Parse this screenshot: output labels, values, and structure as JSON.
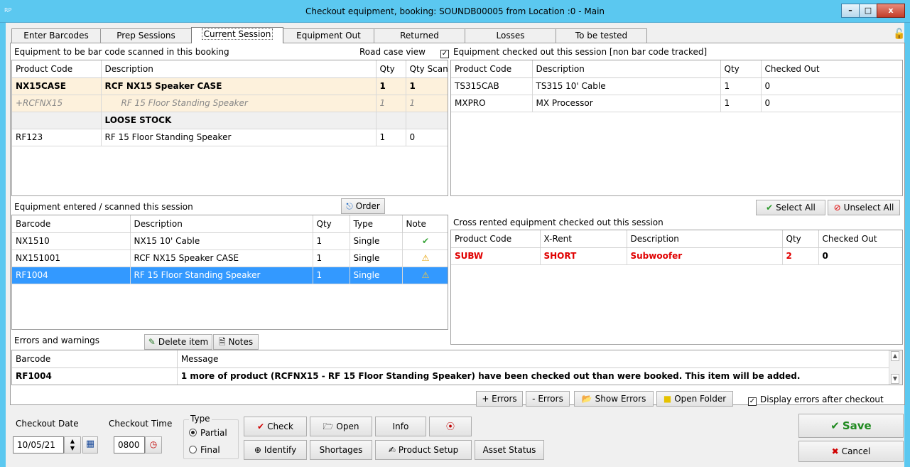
{
  "window": {
    "app_icon": "RP",
    "title": "Checkout equipment,  booking: SOUNDB00005   from Location :0 - Main",
    "min_glyph": "–",
    "max_glyph": "□",
    "close_glyph": "x"
  },
  "tabs": [
    "Enter Barcodes",
    "Prep Sessions",
    "Current Session",
    "Equipment Out",
    "Returned",
    "Losses",
    "To be tested"
  ],
  "booking_grid": {
    "label": "Equipment to be bar code scanned in this booking",
    "road_case_label": "Road case view",
    "road_case_checked": true,
    "columns": [
      "Product Code",
      "Description",
      "Qty",
      "Qty Scanned"
    ],
    "rows": [
      [
        "NX15CASE",
        "RCF NX15 Speaker CASE",
        "1",
        "1"
      ],
      [
        "+RCFNX15",
        "RF 15 Floor Standing Speaker",
        "1",
        "1"
      ],
      [
        "",
        "LOOSE STOCK",
        "",
        ""
      ],
      [
        "RF123",
        "RF 15 Floor Standing Speaker",
        "1",
        "0"
      ]
    ]
  },
  "nonbarcode_grid": {
    "label": "Equipment checked out this session [non bar code tracked]",
    "columns": [
      "Product Code",
      "Description",
      "Qty",
      "Checked Out"
    ],
    "rows": [
      [
        "TS315CAB",
        "TS315 10' Cable",
        "1",
        "0"
      ],
      [
        "MXPRO",
        "MX Processor",
        "1",
        "0"
      ]
    ]
  },
  "scanned_grid": {
    "label": "Equipment entered / scanned this session",
    "order_button": "Order",
    "columns": [
      "Barcode",
      "Description",
      "Qty",
      "Type",
      "Note"
    ],
    "rows": [
      {
        "cells": [
          "NX1510",
          "NX15 10' Cable",
          "1",
          "Single"
        ],
        "note": "ok"
      },
      {
        "cells": [
          "NX151001",
          "RCF NX15 Speaker CASE",
          "1",
          "Single"
        ],
        "note": "warning"
      },
      {
        "cells": [
          "RF1004",
          "RF 15 Floor Standing Speaker",
          "1",
          "Single"
        ],
        "note": "warning"
      }
    ]
  },
  "select_all": "Select All",
  "unselect_all": "Unselect All",
  "cross_grid": {
    "label": "Cross rented equipment checked out this session",
    "columns": [
      "Product Code",
      "X-Rent",
      "Description",
      "Qty",
      "Checked Out"
    ],
    "rows": [
      [
        "SUBW",
        "SHORT",
        "Subwoofer",
        "2",
        "0"
      ]
    ]
  },
  "errors": {
    "label": "Errors and warnings",
    "delete_item": "Delete item",
    "notes": "Notes",
    "columns": [
      "Barcode",
      "Message"
    ],
    "rows": [
      [
        "RF1004",
        "1 more of product (RCFNX15 - RF 15 Floor Standing Speaker) have been checked out than were booked. This item will be added."
      ]
    ]
  },
  "error_buttons": {
    "plus": "+ Errors",
    "minus": "- Errors",
    "show": "Show Errors",
    "open_folder": "Open Folder",
    "display_after": "Display errors after checkout",
    "display_after_checked": true
  },
  "bottom": {
    "checkout_date_label": "Checkout Date",
    "checkout_date": "10/05/21",
    "checkout_time_label": "Checkout Time",
    "checkout_time": "0800",
    "type_label": "Type",
    "type_partial": "Partial",
    "type_final": "Final",
    "type_selected": "Partial",
    "check": "Check",
    "open": "Open",
    "info": "Info",
    "identify": "Identify",
    "shortages": "Shortages",
    "product_setup": "Product Setup",
    "asset_status": "Asset Status",
    "save": "Save",
    "cancel": "Cancel"
  },
  "colors": {
    "titlebar": "#5bc8f0",
    "selection": "#3399ff",
    "error_red": "#e00000",
    "save_green": "#1f8a1f"
  }
}
